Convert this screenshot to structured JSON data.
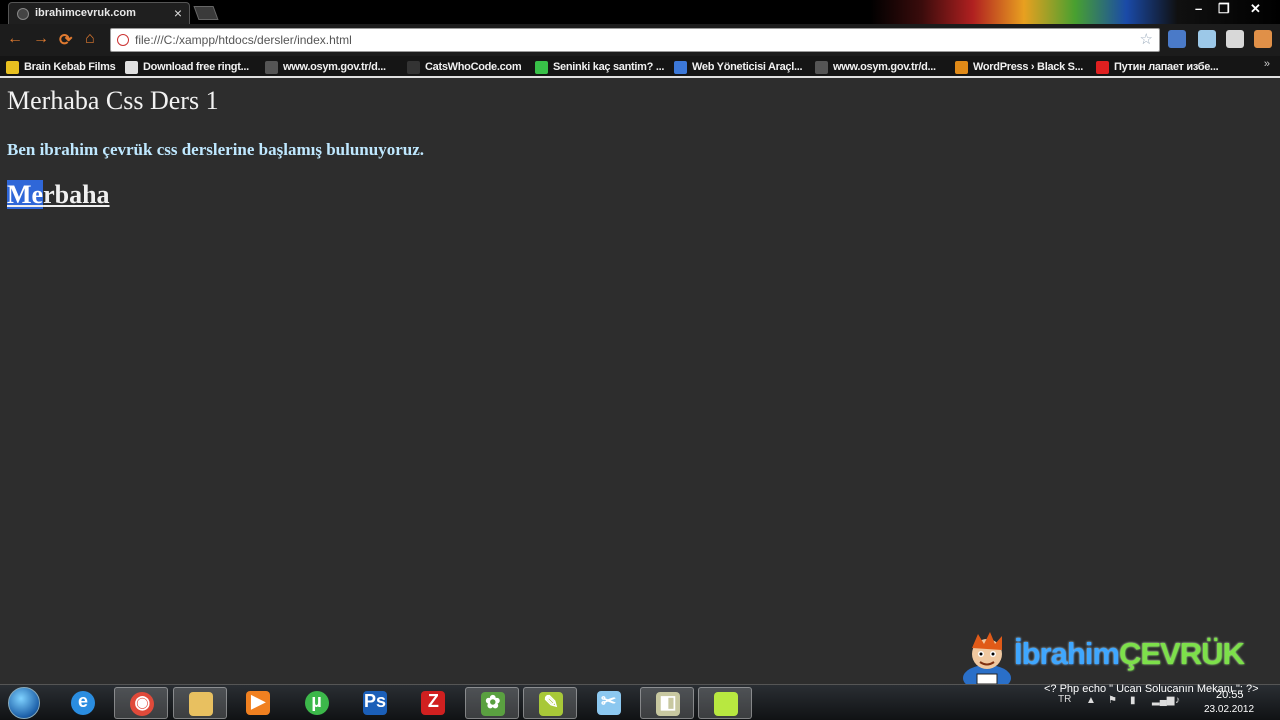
{
  "browser": {
    "tab_title": "ibrahimcevruk.com",
    "tab_close": "×",
    "window_controls": [
      "–",
      "❐",
      "✕"
    ],
    "url": "file:///C:/xampp/htdocs/dersler/index.html",
    "nav": {
      "back": "←",
      "forward": "→",
      "reload": "⟳",
      "home": "⌂"
    }
  },
  "bookmarks": [
    {
      "label": "Brain Kebab Films",
      "icon_color": "#e8c020"
    },
    {
      "label": "Download free ringt...",
      "icon_color": "#e0e0e0"
    },
    {
      "label": "www.osym.gov.tr/d...",
      "icon_color": "#555555"
    },
    {
      "label": "CatsWhoCode.com",
      "icon_color": "#333333"
    },
    {
      "label": "Seninki kaç santim? ...",
      "icon_color": "#38c048"
    },
    {
      "label": "Web Yöneticisi Araçl...",
      "icon_color": "#3c78d8"
    },
    {
      "label": "www.osym.gov.tr/d...",
      "icon_color": "#555555"
    },
    {
      "label": "WordPress › Black S...",
      "icon_color": "#e08a18"
    },
    {
      "label": "Путин лапает избе...",
      "icon_color": "#e02020"
    }
  ],
  "bookmarks_more": "»",
  "page": {
    "heading": "Merhaba Css Ders 1",
    "paragraph": "Ben ibrahim çevrük css derslerine başlamış bulunuyoruz.",
    "link_selected": "Me",
    "link_rest": "rbaha"
  },
  "watermark": {
    "first": "İbrahim",
    "last": "ÇEVRÜK"
  },
  "taskbar": {
    "apps": [
      {
        "name": "internet-explorer",
        "color": "#2a8de0",
        "glyph": "e",
        "active": false
      },
      {
        "name": "chrome",
        "color": "#e04a3a",
        "glyph": "◉",
        "active": true
      },
      {
        "name": "file-explorer",
        "color": "#e8c060",
        "glyph": "",
        "active": true
      },
      {
        "name": "media-player",
        "color": "#f08020",
        "glyph": "▶",
        "active": false
      },
      {
        "name": "utorrent",
        "color": "#3cb84a",
        "glyph": "µ",
        "active": false
      },
      {
        "name": "photoshop",
        "color": "#1b5fb8",
        "glyph": "Ps",
        "active": false
      },
      {
        "name": "filezilla",
        "color": "#d02020",
        "glyph": "Z",
        "active": false
      },
      {
        "name": "msn-messenger",
        "color": "#5aa040",
        "glyph": "✿",
        "active": true
      },
      {
        "name": "notepad",
        "color": "#a8c838",
        "glyph": "✎",
        "active": true
      },
      {
        "name": "snipping-tool",
        "color": "#8cc8f0",
        "glyph": "✂",
        "active": false
      },
      {
        "name": "camtasia",
        "color": "#c8c8a0",
        "glyph": "◧",
        "active": true
      },
      {
        "name": "sticky-notes",
        "color": "#b8e840",
        "glyph": "",
        "active": true
      }
    ],
    "tray_tooltip": "<? Php echo \" Ucan Solucanın Mekanı \"; ?>",
    "language": "TR",
    "time": "20:55",
    "date": "23.02.2012"
  }
}
